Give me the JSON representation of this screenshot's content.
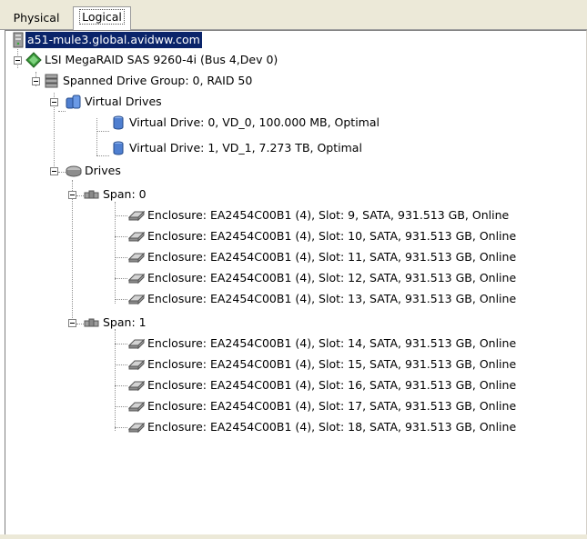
{
  "tabs": {
    "physical": "Physical",
    "logical": "Logical"
  },
  "tree": {
    "root": "a51-mule3.global.avidww.com",
    "controller": "LSI MegaRAID SAS 9260-4i (Bus 4,Dev 0)",
    "drive_group": "Spanned Drive Group: 0, RAID  50",
    "virtual_drives_label": "Virtual Drives",
    "virtual_drives": [
      "Virtual Drive: 0, VD_0, 100.000  MB, Optimal",
      "Virtual Drive: 1, VD_1, 7.273 TB, Optimal"
    ],
    "drives_label": "Drives",
    "spans": [
      {
        "label": "Span: 0",
        "disks": [
          "Enclosure: EA2454C00B1 (4), Slot: 9, SATA, 931.513 GB, Online",
          "Enclosure: EA2454C00B1 (4), Slot: 10, SATA, 931.513 GB, Online",
          "Enclosure: EA2454C00B1 (4), Slot: 11, SATA, 931.513 GB, Online",
          "Enclosure: EA2454C00B1 (4), Slot: 12, SATA, 931.513 GB, Online",
          "Enclosure: EA2454C00B1 (4), Slot: 13, SATA, 931.513 GB, Online"
        ]
      },
      {
        "label": "Span: 1",
        "disks": [
          "Enclosure: EA2454C00B1 (4), Slot: 14, SATA, 931.513 GB, Online",
          "Enclosure: EA2454C00B1 (4), Slot: 15, SATA, 931.513 GB, Online",
          "Enclosure: EA2454C00B1 (4), Slot: 16, SATA, 931.513 GB, Online",
          "Enclosure: EA2454C00B1 (4), Slot: 17, SATA, 931.513 GB, Online",
          "Enclosure: EA2454C00B1 (4), Slot: 18, SATA, 931.513 GB, Online"
        ]
      }
    ]
  },
  "icons": {
    "root": "server-icon",
    "controller": "raid-controller-icon",
    "drive_group": "drive-group-icon",
    "virtual_drives": "virtual-drives-folder-icon",
    "virtual_drive": "virtual-drive-icon",
    "drives": "drives-folder-icon",
    "span": "span-icon",
    "disk": "physical-disk-icon"
  },
  "colors": {
    "selection": "#0a246a",
    "tab_bar": "#ece9d8"
  }
}
